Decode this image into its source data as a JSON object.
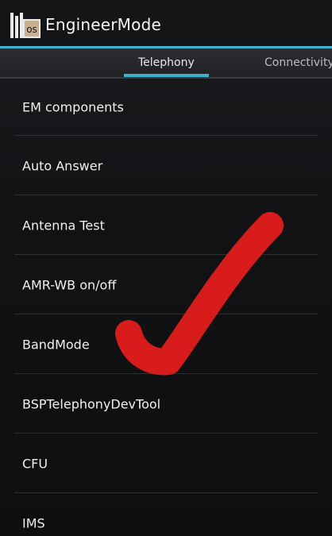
{
  "app": {
    "title": "EngineerMode",
    "icon_text": "os",
    "icon": "engineer-mode-app-icon"
  },
  "tabs": [
    {
      "label": "Telephony",
      "selected": true
    },
    {
      "label": "Connectivity",
      "selected": false
    }
  ],
  "list": {
    "items": [
      {
        "label": "EM components"
      },
      {
        "label": "Auto Answer"
      },
      {
        "label": "Antenna Test"
      },
      {
        "label": "AMR-WB on/off"
      },
      {
        "label": "BandMode"
      },
      {
        "label": "BSPTelephonyDevTool"
      },
      {
        "label": "CFU"
      },
      {
        "label": "IMS"
      }
    ]
  },
  "colors": {
    "accent": "#3fb1cf",
    "checkmark": "#d81c1c",
    "background": "#111214",
    "text": "#f0f0f0"
  }
}
